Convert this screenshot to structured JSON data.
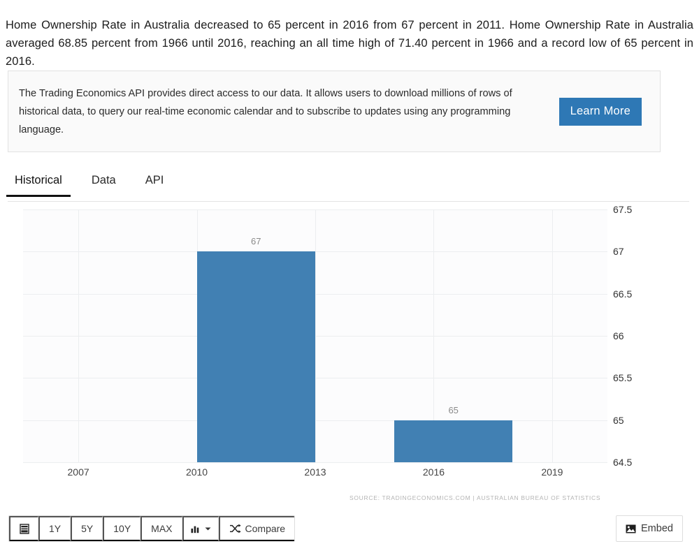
{
  "intro": {
    "paragraph": "Home Ownership Rate in Australia decreased to 65 percent in 2016 from 67 percent in 2011. Home Ownership Rate in Australia averaged 68.85 percent from 1966 until 2016, reaching an all time high of 71.40 percent in 1966 and a record low of 65 percent in 2016."
  },
  "api_banner": {
    "text": "The Trading Economics API provides direct access to our data. It allows users to download millions of rows of historical data, to query our real-time economic calendar and to subscribe to updates using any programming language.",
    "button_label": "Learn More",
    "button_color": "#2e78b5"
  },
  "tabs": [
    {
      "label": "Historical",
      "active": true
    },
    {
      "label": "Data",
      "active": false
    },
    {
      "label": "API",
      "active": false
    }
  ],
  "chart_data": {
    "type": "bar",
    "title": "",
    "xlabel": "",
    "ylabel": "",
    "categories": [
      "2011",
      "2016"
    ],
    "values": [
      67,
      65
    ],
    "data_labels": [
      "67",
      "65"
    ],
    "ylim": [
      64.5,
      67.5
    ],
    "ytick_labels": [
      "67.5",
      "67",
      "66.5",
      "66",
      "65.5",
      "65",
      "64.5"
    ],
    "ytick_values": [
      67.5,
      67,
      66.5,
      66,
      65.5,
      65,
      64.5
    ],
    "xtick_labels": [
      "2007",
      "2010",
      "2013",
      "2016",
      "2019"
    ],
    "xtick_values": [
      2007,
      2010,
      2013,
      2016,
      2019
    ],
    "xlim": [
      2005.6,
      2020.4
    ],
    "grid": true,
    "legend": "none",
    "bar_color": "#4180b3",
    "source": "SOURCE: TRADINGECONOMICS.COM | AUSTRALIAN BUREAU OF STATISTICS"
  },
  "toolbar": {
    "buttons": [
      {
        "name": "calendar-range",
        "label": "",
        "icon": "calendar-icon"
      },
      {
        "name": "range-1y",
        "label": "1Y",
        "icon": ""
      },
      {
        "name": "range-5y",
        "label": "5Y",
        "icon": ""
      },
      {
        "name": "range-10y",
        "label": "10Y",
        "icon": ""
      },
      {
        "name": "range-max",
        "label": "MAX",
        "icon": ""
      },
      {
        "name": "chart-type",
        "label": "",
        "icon": "bar-chart-icon"
      },
      {
        "name": "compare",
        "label": "Compare",
        "icon": "shuffle-icon"
      }
    ],
    "embed_label": "Embed"
  }
}
